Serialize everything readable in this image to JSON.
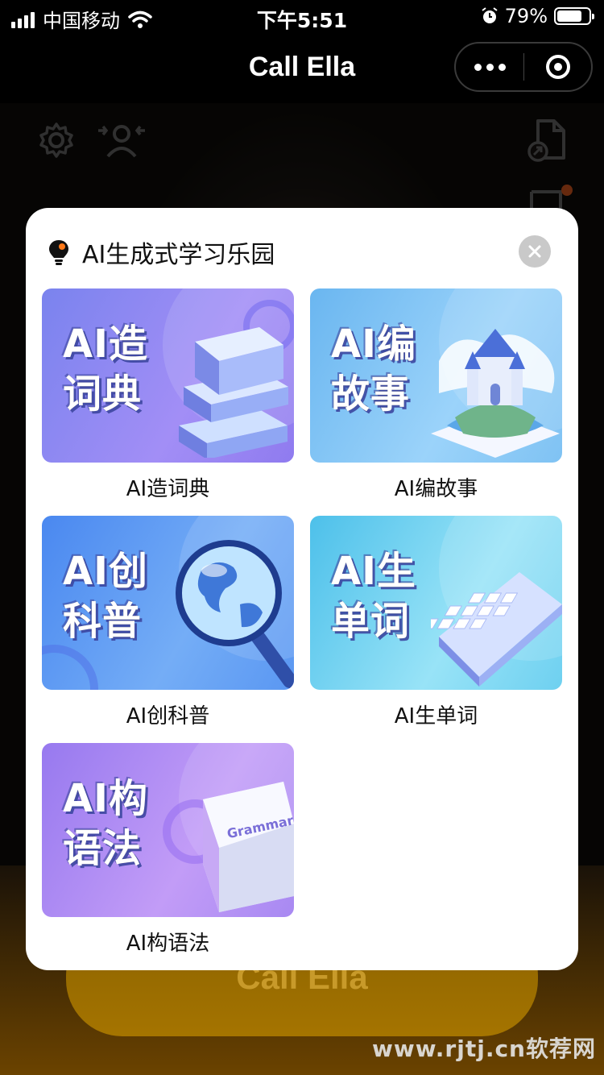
{
  "status_bar": {
    "carrier": "中国移动",
    "time": "下午5:51",
    "battery_percent": "79%",
    "battery_level": 0.79,
    "icons": [
      "signal-icon",
      "wifi-icon",
      "alarm-icon",
      "battery-icon"
    ]
  },
  "nav": {
    "title": "Call Ella",
    "icons": [
      "more-dots-icon",
      "miniprogram-close-icon"
    ]
  },
  "background": {
    "call_button_label": "Call Ella",
    "watermark": "www.rjtj.cn软荐网",
    "icons": [
      "settings-gear-icon",
      "switch-user-icon",
      "export-file-icon",
      "notes-icon"
    ]
  },
  "modal": {
    "title": "AI生成式学习乐园",
    "title_icon": "lightbulb-icon",
    "close_icon": "close-icon",
    "cards": [
      {
        "tile_line1": "AI造",
        "tile_line2": "词典",
        "label": "AI造词典",
        "art": "books-illustration",
        "colors": [
          "#7b86f0",
          "#a48cf5"
        ]
      },
      {
        "tile_line1": "AI编",
        "tile_line2": "故事",
        "label": "AI编故事",
        "art": "castle-book-illustration",
        "colors": [
          "#69b8f0",
          "#9ed6fa"
        ]
      },
      {
        "tile_line1": "AI创",
        "tile_line2": "科普",
        "label": "AI创科普",
        "art": "globe-magnifier-illustration",
        "colors": [
          "#4d8cf2",
          "#7ab0f7"
        ]
      },
      {
        "tile_line1": "AI生",
        "tile_line2": "单词",
        "label": "AI生单词",
        "art": "keyboard-illustration",
        "colors": [
          "#4fc3ea",
          "#9be6f7"
        ]
      },
      {
        "tile_line1": "AI构",
        "tile_line2": "语法",
        "label": "AI构语法",
        "art": "grammar-book-illustration",
        "book_text": "Grammar",
        "colors": [
          "#9a7df0",
          "#c39ef7"
        ]
      }
    ]
  }
}
